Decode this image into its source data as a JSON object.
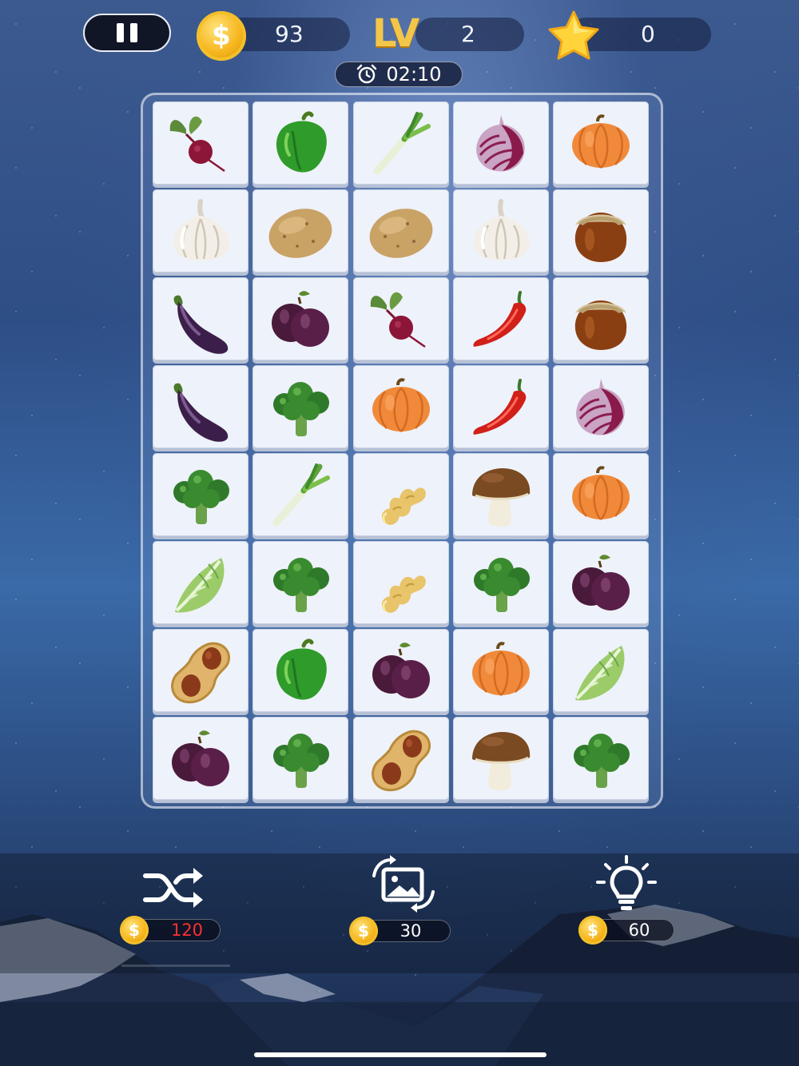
{
  "hud": {
    "coins": "93",
    "level_label": "LV",
    "level": "2",
    "stars": "0",
    "timer": "02:10"
  },
  "board": {
    "rows": [
      [
        "beetroot-icon",
        "green-pepper-icon",
        "leek-icon",
        "red-onion-icon",
        "pumpkin-icon"
      ],
      [
        "garlic-icon",
        "potato-icon",
        "potato-icon",
        "garlic-icon",
        "hazelnut-icon"
      ],
      [
        "eggplant-icon",
        "plum-icon",
        "beetroot-icon",
        "chili-pepper-icon",
        "hazelnut-icon"
      ],
      [
        "eggplant-icon",
        "broccoli-icon",
        "pumpkin-icon",
        "chili-pepper-icon",
        "red-onion-icon"
      ],
      [
        "broccoli-icon",
        "leek-icon",
        "ginger-icon",
        "mushroom-icon",
        "pumpkin-icon"
      ],
      [
        "lettuce-icon",
        "broccoli-icon",
        "ginger-icon",
        "broccoli-icon",
        "plum-icon"
      ],
      [
        "peanut-icon",
        "green-pepper-icon",
        "plum-icon",
        "pumpkin-icon",
        "lettuce-icon"
      ],
      [
        "plum-icon",
        "broccoli-icon",
        "peanut-icon",
        "mushroom-icon",
        "broccoli-icon"
      ]
    ]
  },
  "tools": {
    "shuffle": {
      "icon": "shuffle-icon",
      "cost": "120",
      "cost_color": "#ff2f2f"
    },
    "refresh_image": {
      "icon": "image-refresh-icon",
      "cost": "30"
    },
    "hint": {
      "icon": "lightbulb-icon",
      "cost": "60"
    }
  },
  "colors": {
    "coin": "#f6b51c",
    "level": "#f3c64a",
    "tile": "#eef2fa"
  }
}
